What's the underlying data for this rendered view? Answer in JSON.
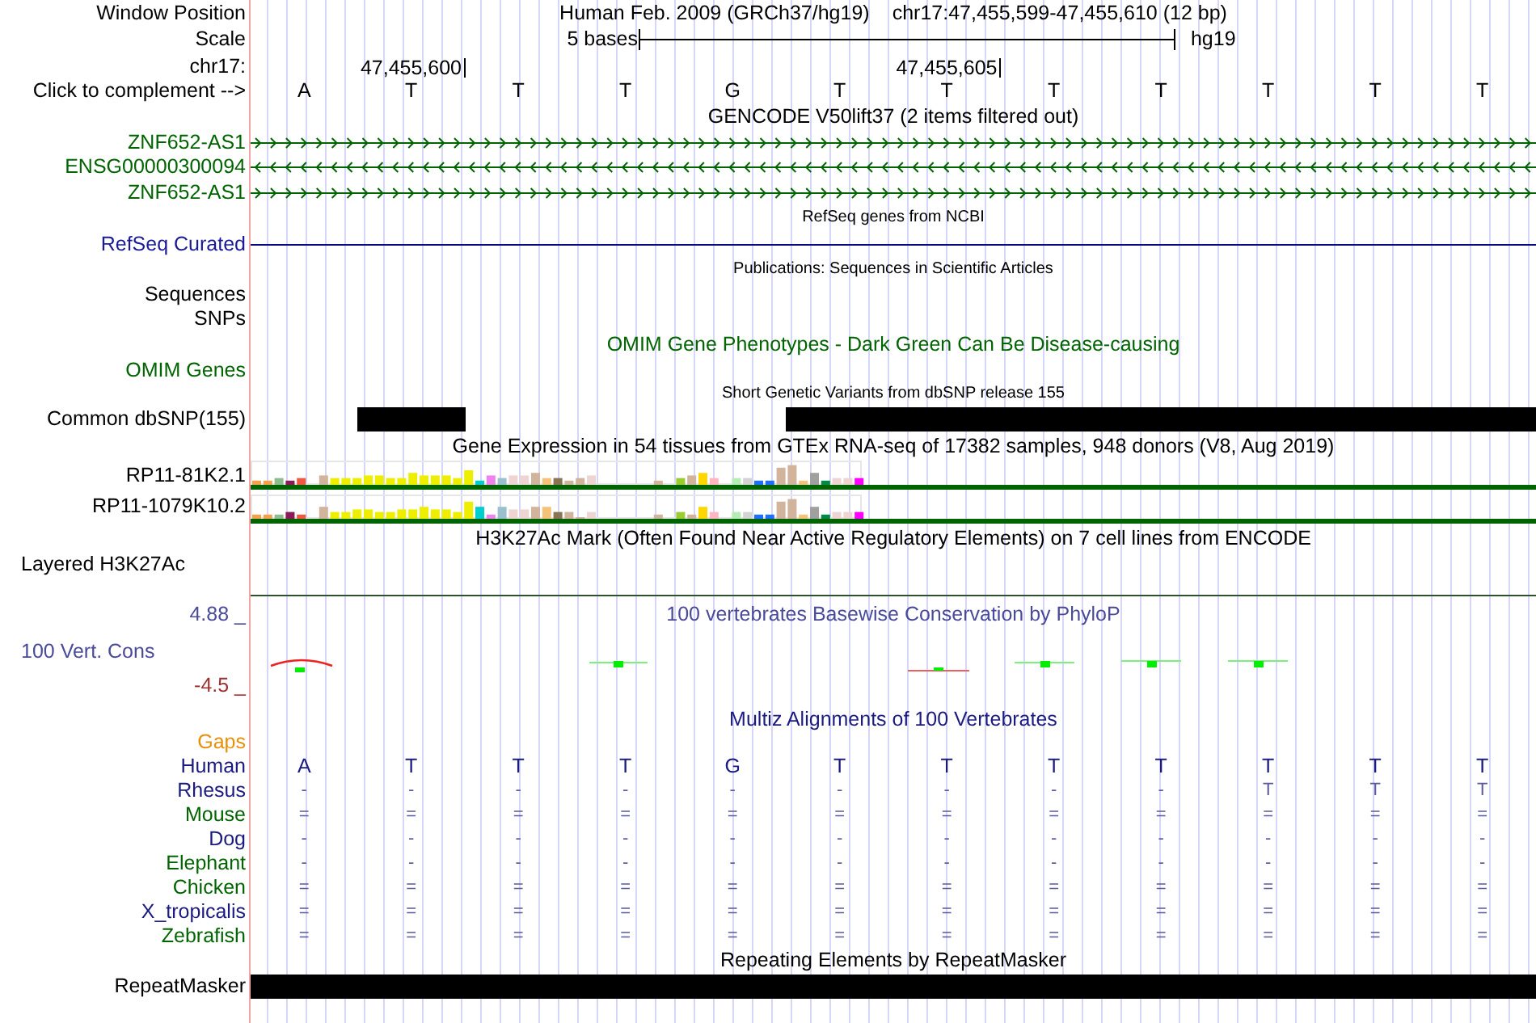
{
  "position": {
    "label": "Window Position",
    "assembly": "Human Feb. 2009 (GRCh37/hg19)",
    "range": "chr17:47,455,599-47,455,610 (12 bp)"
  },
  "scale": {
    "label": "Scale",
    "span": "5 bases",
    "assembly": "hg19"
  },
  "coordinates": {
    "label": "chr17:"
  },
  "bases": {
    "label": "Click to complement -->",
    "items": [
      {
        "letter": "A"
      },
      {
        "letter": "T",
        "tick": "47,455,600"
      },
      {
        "letter": "T"
      },
      {
        "letter": "T"
      },
      {
        "letter": "G"
      },
      {
        "letter": "T"
      },
      {
        "letter": "T",
        "tick": "47,455,605"
      },
      {
        "letter": "T"
      },
      {
        "letter": "T"
      },
      {
        "letter": "T"
      },
      {
        "letter": "T"
      },
      {
        "letter": "T"
      }
    ]
  },
  "gencode": {
    "title": "GENCODE V50lift37 (2 items filtered out)",
    "genes": [
      {
        "name": "ZNF652-AS1",
        "reverse": false
      },
      {
        "name": "ENSG00000300094",
        "reverse": true
      },
      {
        "name": "ZNF652-AS1",
        "reverse": false
      }
    ]
  },
  "refseq": {
    "title": "RefSeq genes from NCBI",
    "label": "RefSeq Curated"
  },
  "publications": {
    "title": "Publications: Sequences in Scientific Articles",
    "labels": [
      "Sequences",
      "SNPs"
    ]
  },
  "omim": {
    "title": "OMIM Gene Phenotypes - Dark Green Can Be Disease-causing",
    "label": "OMIM Genes"
  },
  "dbsnp": {
    "title": "Short Genetic Variants from dbSNP release 155",
    "label": "Common dbSNP(155)",
    "variant_bases": [
      false,
      true,
      false,
      false,
      false,
      true,
      true,
      true,
      true,
      true,
      true,
      true
    ]
  },
  "gtex": {
    "title": "Gene Expression in 54 tissues from GTEx RNA-seq of 17382 samples, 948 donors (V8, Aug 2019)",
    "genes": [
      {
        "name": "RP11-81K2.1"
      },
      {
        "name": "RP11-1079K10.2"
      }
    ]
  },
  "h3k27ac": {
    "title": "H3K27Ac Mark (Often Found Near Active Regulatory Elements) on 7 cell lines from ENCODE",
    "label": "Layered H3K27Ac"
  },
  "phylop": {
    "title": "100 vertebrates Basewise Conservation by PhyloP",
    "label": "100 Vert. Cons",
    "max": "4.88 _",
    "min": "-4.5 _"
  },
  "multiz": {
    "title": "Multiz Alignments of 100 Vertebrates",
    "gaps_label": "Gaps",
    "species": [
      {
        "name": "Human",
        "color": "#1a1a80",
        "cells": [
          "A",
          "T",
          "T",
          "T",
          "G",
          "T",
          "T",
          "T",
          "T",
          "T",
          "T",
          "T"
        ]
      },
      {
        "name": "Rhesus",
        "color": "#1a1a80",
        "cells": [
          "-",
          "-",
          "-",
          "-",
          "-",
          "-",
          "-",
          "-",
          "-",
          "T",
          "T",
          "T"
        ]
      },
      {
        "name": "Mouse",
        "color": "#006400",
        "cells": [
          "=",
          "=",
          "=",
          "=",
          "=",
          "=",
          "=",
          "=",
          "=",
          "=",
          "=",
          "="
        ]
      },
      {
        "name": "Dog",
        "color": "#1a1a80",
        "cells": [
          "-",
          "-",
          "-",
          "-",
          "-",
          "-",
          "-",
          "-",
          "-",
          "-",
          "-",
          "-"
        ]
      },
      {
        "name": "Elephant",
        "color": "#006400",
        "cells": [
          "-",
          "-",
          "-",
          "-",
          "-",
          "-",
          "-",
          "-",
          "-",
          "-",
          "-",
          "-"
        ]
      },
      {
        "name": "Chicken",
        "color": "#006400",
        "cells": [
          "=",
          "=",
          "=",
          "=",
          "=",
          "=",
          "=",
          "=",
          "=",
          "=",
          "=",
          "="
        ]
      },
      {
        "name": "X_tropicalis",
        "color": "#1a1a80",
        "cells": [
          "=",
          "=",
          "=",
          "=",
          "=",
          "=",
          "=",
          "=",
          "=",
          "=",
          "=",
          "="
        ]
      },
      {
        "name": "Zebrafish",
        "color": "#006400",
        "cells": [
          "=",
          "=",
          "=",
          "=",
          "=",
          "=",
          "=",
          "=",
          "=",
          "=",
          "=",
          "="
        ]
      }
    ]
  },
  "repeatmasker": {
    "title": "Repeating Elements by RepeatMasker",
    "label": "RepeatMasker"
  }
}
